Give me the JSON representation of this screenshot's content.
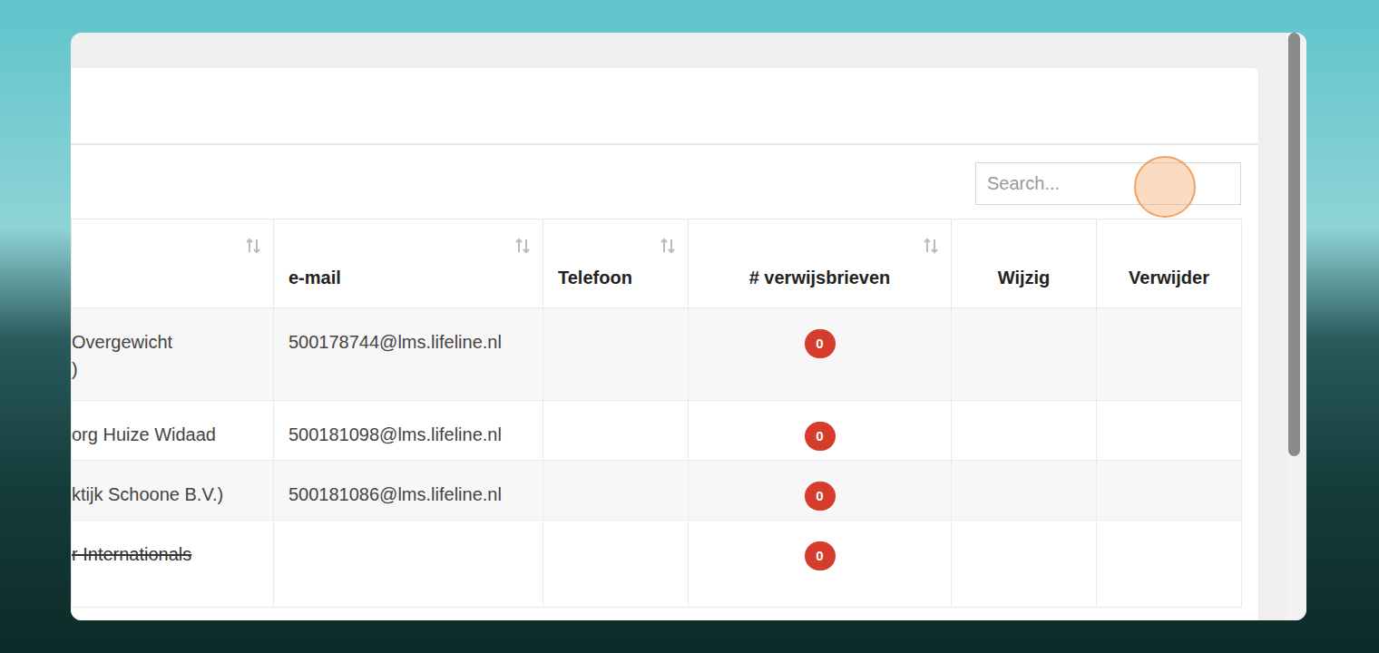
{
  "search": {
    "placeholder": "Search..."
  },
  "table": {
    "columns": [
      {
        "label": "",
        "sortable": true
      },
      {
        "label": "e-mail",
        "sortable": true
      },
      {
        "label": "Telefoon",
        "sortable": true
      },
      {
        "label": "# verwijsbrieven",
        "sortable": true
      },
      {
        "label": "Wijzig",
        "sortable": false
      },
      {
        "label": "Verwijder",
        "sortable": false
      }
    ],
    "rows": [
      {
        "name_lines": [
          "Overgewicht",
          ")"
        ],
        "email": "500178744@lms.lifeline.nl",
        "count": "0",
        "deleted": false
      },
      {
        "name_lines": [
          "org Huize Widaad"
        ],
        "email": "500181098@lms.lifeline.nl",
        "count": "0",
        "deleted": false
      },
      {
        "name_lines": [
          "ktijk Schoone B.V.)"
        ],
        "email": "500181086@lms.lifeline.nl",
        "count": "0",
        "deleted": false
      },
      {
        "name_lines": [
          "r Internationals"
        ],
        "email": "",
        "count": "0",
        "deleted": true
      }
    ]
  }
}
